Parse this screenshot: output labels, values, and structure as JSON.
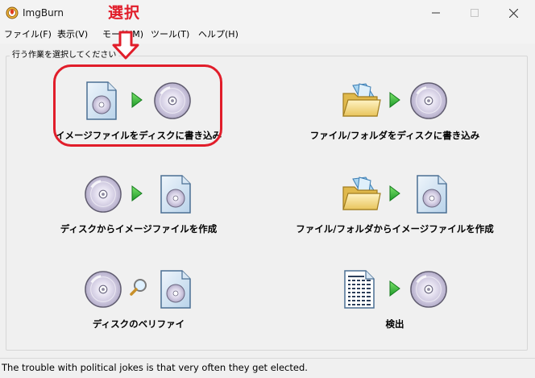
{
  "window": {
    "title": "ImgBurn"
  },
  "menu": {
    "items": [
      {
        "label": "ファイル(F)"
      },
      {
        "label": "表示(V)"
      },
      {
        "label": "モード(M)"
      },
      {
        "label": "ツール(T)"
      },
      {
        "label": "ヘルプ(H)"
      }
    ]
  },
  "group": {
    "title": "行う作業を選択してください"
  },
  "actions": [
    {
      "label": "イメージファイルをディスクに書き込み",
      "icons": [
        "image-file-icon",
        "play-arrow-icon",
        "disc-icon"
      ]
    },
    {
      "label": "ファイル/フォルダをディスクに書き込み",
      "icons": [
        "folder-icon",
        "play-arrow-icon",
        "disc-icon"
      ]
    },
    {
      "label": "ディスクからイメージファイルを作成",
      "icons": [
        "disc-icon",
        "play-arrow-icon",
        "image-file-icon"
      ]
    },
    {
      "label": "ファイル/フォルダからイメージファイルを作成",
      "icons": [
        "folder-icon",
        "play-arrow-icon",
        "image-file-icon"
      ]
    },
    {
      "label": "ディスクのベリファイ",
      "icons": [
        "disc-icon",
        "magnifier-icon",
        "image-file-icon"
      ]
    },
    {
      "label": "検出",
      "icons": [
        "binary-document-icon",
        "play-arrow-icon",
        "disc-icon"
      ]
    }
  ],
  "annotation": {
    "text": "選択",
    "color": "#e11d2a"
  },
  "status": {
    "text": "The trouble with political jokes is that very often they get elected."
  }
}
